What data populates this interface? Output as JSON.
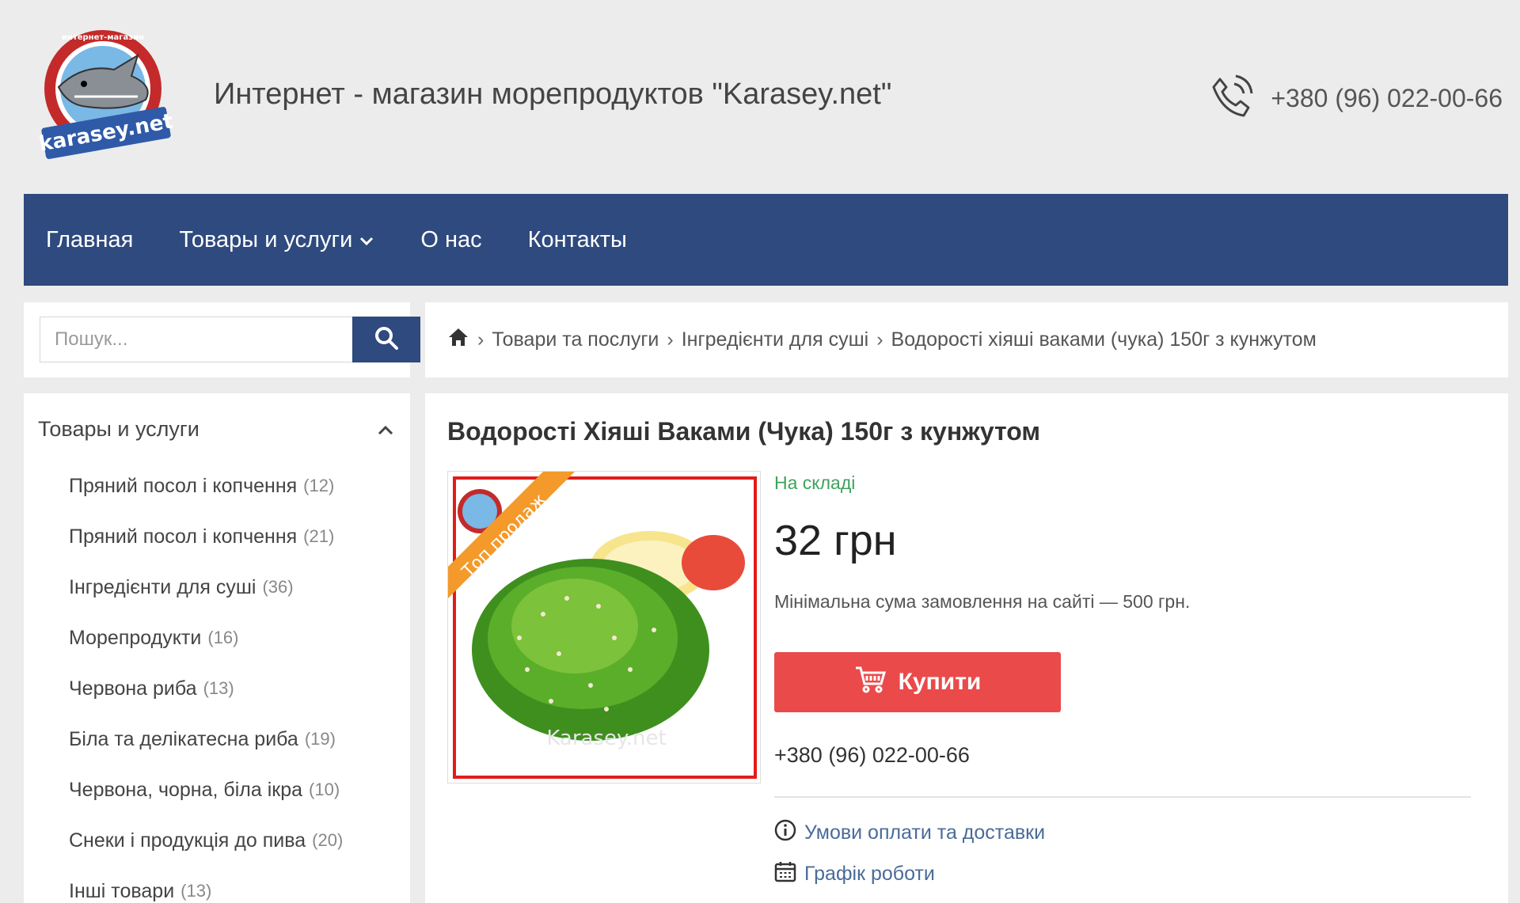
{
  "header": {
    "site_title": "Интернет - магазин морепродуктов \"Karasey.net\"",
    "phone": "+380 (96) 022-00-66",
    "logo_text": "karasey.net",
    "logo_arc_text": "интернет-магазин"
  },
  "nav": {
    "items": [
      {
        "label": "Главная"
      },
      {
        "label": "Товары и услуги",
        "has_dropdown": true
      },
      {
        "label": "О нас"
      },
      {
        "label": "Контакты"
      }
    ]
  },
  "search": {
    "placeholder": "Пошук..."
  },
  "breadcrumb": {
    "items": [
      "Товари та послуги",
      "Інгредієнти для суші",
      "Водорості хіяші ваками (чука) 150г з кунжутом"
    ]
  },
  "sidebar": {
    "heading": "Товары и услуги",
    "categories": [
      {
        "label": "Пряний посол і копчення",
        "count": "(12)"
      },
      {
        "label": "Пряний посол і копчення",
        "count": "(21)"
      },
      {
        "label": "Інгредієнти для суші",
        "count": "(36)"
      },
      {
        "label": "Морепродукти",
        "count": "(16)"
      },
      {
        "label": "Червона риба",
        "count": "(13)"
      },
      {
        "label": "Біла та делікатесна риба",
        "count": "(19)"
      },
      {
        "label": "Червона, чорна, біла ікра",
        "count": "(10)"
      },
      {
        "label": "Снеки і продукція до пива",
        "count": "(20)"
      },
      {
        "label": "Інші товари",
        "count": "(13)"
      }
    ]
  },
  "product": {
    "title": "Водорості Хіяші Ваками (Чука) 150г з кунжутом",
    "badge": "Топ продаж",
    "watermark": "Karasey.net",
    "stock": "На складі",
    "price": "32 грн",
    "min_order": "Мінімальна сума замовлення на сайті — 500 грн.",
    "buy_label": "Купити",
    "phone": "+380 (96) 022-00-66",
    "links": {
      "payment": "Умови оплати та доставки",
      "schedule": "Графік роботи"
    }
  },
  "colors": {
    "nav_bg": "#2e4a7e",
    "buy_button": "#ea4a4a",
    "stock_green": "#3fa15d",
    "badge_orange": "#f39a2b",
    "link_blue": "#4a6b9a"
  },
  "icons": {
    "phone": "phone-icon",
    "search": "search-icon",
    "home": "home-icon",
    "cart": "cart-icon",
    "info": "info-icon",
    "calendar": "calendar-icon",
    "chevron_down": "chevron-down-icon",
    "chevron_up": "chevron-up-icon"
  }
}
